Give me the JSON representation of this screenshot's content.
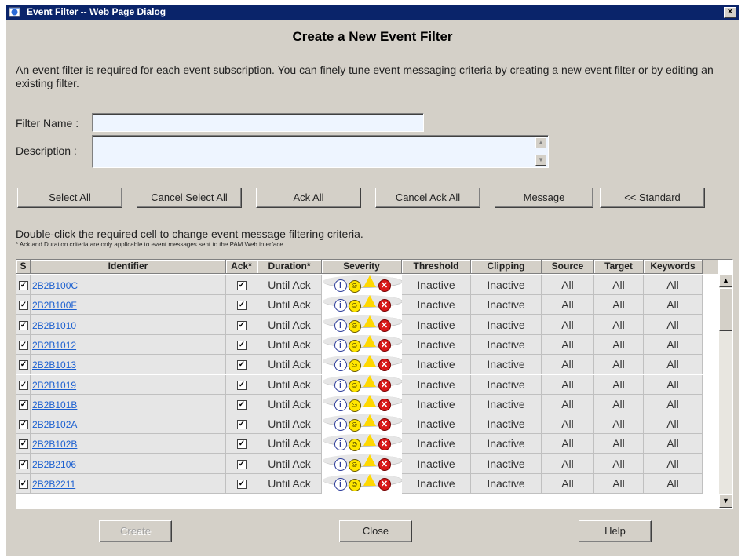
{
  "window": {
    "title": "Event Filter -- Web Page Dialog",
    "close_glyph": "×"
  },
  "heading": "Create a New Event Filter",
  "intro": "An event filter is required for each event subscription. You can finely tune event messaging criteria by creating a new event filter or by editing an existing filter.",
  "form": {
    "filter_name_label": "Filter Name :",
    "filter_name_value": "",
    "description_label": "Description :",
    "description_value": ""
  },
  "toolbar": {
    "select_all": "Select All",
    "cancel_select_all": "Cancel Select All",
    "ack_all": "Ack All",
    "cancel_ack_all": "Cancel Ack All",
    "message": "Message",
    "standard": "<< Standard"
  },
  "hint": "Double-click the required cell to change event message filtering criteria.",
  "note": "* Ack and Duration criteria are only applicable to event messages sent to the PAM Web interface.",
  "grid": {
    "columns": [
      "S",
      "Identifier",
      "Ack*",
      "Duration*",
      "Severity",
      "Threshold",
      "Clipping",
      "Source",
      "Target",
      "Keywords"
    ],
    "rows": [
      {
        "id": "2B2B100C",
        "duration": "Until Ack",
        "threshold": "Inactive",
        "clipping": "Inactive",
        "source": "All",
        "target": "All",
        "keywords": "All"
      },
      {
        "id": "2B2B100F",
        "duration": "Until Ack",
        "threshold": "Inactive",
        "clipping": "Inactive",
        "source": "All",
        "target": "All",
        "keywords": "All"
      },
      {
        "id": "2B2B1010",
        "duration": "Until Ack",
        "threshold": "Inactive",
        "clipping": "Inactive",
        "source": "All",
        "target": "All",
        "keywords": "All"
      },
      {
        "id": "2B2B1012",
        "duration": "Until Ack",
        "threshold": "Inactive",
        "clipping": "Inactive",
        "source": "All",
        "target": "All",
        "keywords": "All"
      },
      {
        "id": "2B2B1013",
        "duration": "Until Ack",
        "threshold": "Inactive",
        "clipping": "Inactive",
        "source": "All",
        "target": "All",
        "keywords": "All"
      },
      {
        "id": "2B2B1019",
        "duration": "Until Ack",
        "threshold": "Inactive",
        "clipping": "Inactive",
        "source": "All",
        "target": "All",
        "keywords": "All"
      },
      {
        "id": "2B2B101B",
        "duration": "Until Ack",
        "threshold": "Inactive",
        "clipping": "Inactive",
        "source": "All",
        "target": "All",
        "keywords": "All"
      },
      {
        "id": "2B2B102A",
        "duration": "Until Ack",
        "threshold": "Inactive",
        "clipping": "Inactive",
        "source": "All",
        "target": "All",
        "keywords": "All"
      },
      {
        "id": "2B2B102B",
        "duration": "Until Ack",
        "threshold": "Inactive",
        "clipping": "Inactive",
        "source": "All",
        "target": "All",
        "keywords": "All"
      },
      {
        "id": "2B2B2106",
        "duration": "Until Ack",
        "threshold": "Inactive",
        "clipping": "Inactive",
        "source": "All",
        "target": "All",
        "keywords": "All"
      },
      {
        "id": "2B2B2211",
        "duration": "Until Ack",
        "threshold": "Inactive",
        "clipping": "Inactive",
        "source": "All",
        "target": "All",
        "keywords": "All"
      }
    ],
    "check_glyph": "✓",
    "severity_icons": [
      "info-icon",
      "smiley-icon",
      "warning-icon",
      "error-icon"
    ]
  },
  "footer": {
    "create": "Create",
    "close": "Close",
    "help": "Help"
  }
}
